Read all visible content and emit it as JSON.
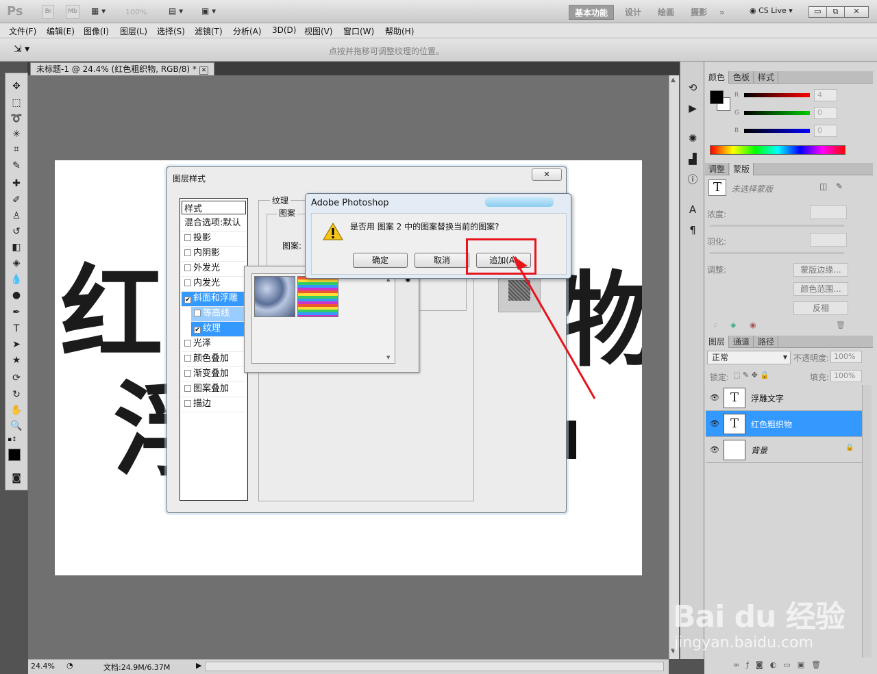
{
  "app": {
    "logo": "Ps",
    "br": "Br",
    "mb": "Mb",
    "zoom": "100%",
    "workspaces": [
      "基本功能",
      "设计",
      "绘画",
      "摄影"
    ],
    "more": "»",
    "cslive": "CS Live ▾"
  },
  "menus": [
    "文件(F)",
    "编辑(E)",
    "图像(I)",
    "图层(L)",
    "选择(S)",
    "滤镜(T)",
    "分析(A)",
    "3D(D)",
    "视图(V)",
    "窗口(W)",
    "帮助(H)"
  ],
  "options": {
    "hint": "点按并拖移可调整纹理的位置。"
  },
  "document": {
    "tab": "未标题-1 @ 24.4% (红色粗织物, RGB/8) *",
    "zoom": "24.4%",
    "docsize": "文档:24.9M/6.37M"
  },
  "layer_style": {
    "title": "图层样式",
    "list_header": "样式",
    "items": [
      {
        "label": "混合选项:默认",
        "cb": false,
        "state": "header"
      },
      {
        "label": "投影",
        "cb": true,
        "checked": false,
        "state": ""
      },
      {
        "label": "内阴影",
        "cb": true,
        "checked": false,
        "state": ""
      },
      {
        "label": "外发光",
        "cb": true,
        "checked": false,
        "state": ""
      },
      {
        "label": "内发光",
        "cb": true,
        "checked": false,
        "state": ""
      },
      {
        "label": "斜面和浮雕",
        "cb": true,
        "checked": true,
        "state": "sel"
      },
      {
        "label": "等高线",
        "cb": true,
        "checked": false,
        "state": "sub"
      },
      {
        "label": "纹理",
        "cb": true,
        "checked": true,
        "state": "subsel"
      },
      {
        "label": "光泽",
        "cb": true,
        "checked": false,
        "state": ""
      },
      {
        "label": "颜色叠加",
        "cb": true,
        "checked": false,
        "state": ""
      },
      {
        "label": "渐变叠加",
        "cb": true,
        "checked": false,
        "state": ""
      },
      {
        "label": "图案叠加",
        "cb": true,
        "checked": false,
        "state": ""
      },
      {
        "label": "描边",
        "cb": true,
        "checked": false,
        "state": ""
      }
    ],
    "group_texture": "纹理",
    "group_pattern": "图案",
    "pattern_label": "图案:"
  },
  "alert": {
    "title": "Adobe Photoshop",
    "message": "是否用 图案 2 中的图案替换当前的图案?",
    "ok": "确定",
    "cancel": "取消",
    "append": "追加(A)"
  },
  "canvas_text": {
    "c1": "红",
    "c2": "物",
    "c3": "浮"
  },
  "color_panel": {
    "tabs": [
      "颜色",
      "色板",
      "样式"
    ],
    "r": "4",
    "g": "0",
    "b": "0",
    "r_label": "R",
    "g_label": "G",
    "b_label": "B"
  },
  "masks_panel": {
    "tabs": [
      "调整",
      "蒙版"
    ],
    "no_mask": "未选择蒙版",
    "density": "浓度:",
    "feather": "羽化:",
    "adjust": "调整:",
    "btn1": "蒙版边缘...",
    "btn2": "颜色范围...",
    "btn3": "反相"
  },
  "layers_panel": {
    "tabs": [
      "图层",
      "通道",
      "路径"
    ],
    "blend": "正常",
    "opacity_label": "不透明度:",
    "opacity": "100%",
    "lock_label": "锁定:",
    "fill_label": "填充:",
    "fill": "100%",
    "layers": [
      {
        "name": "浮雕文字",
        "thumb": "T"
      },
      {
        "name": "红色粗织物",
        "thumb": "T"
      },
      {
        "name": "背景",
        "thumb": ""
      }
    ]
  },
  "watermark": {
    "brand": "Bai du 经验",
    "url": "jingyan.baidu.com"
  }
}
